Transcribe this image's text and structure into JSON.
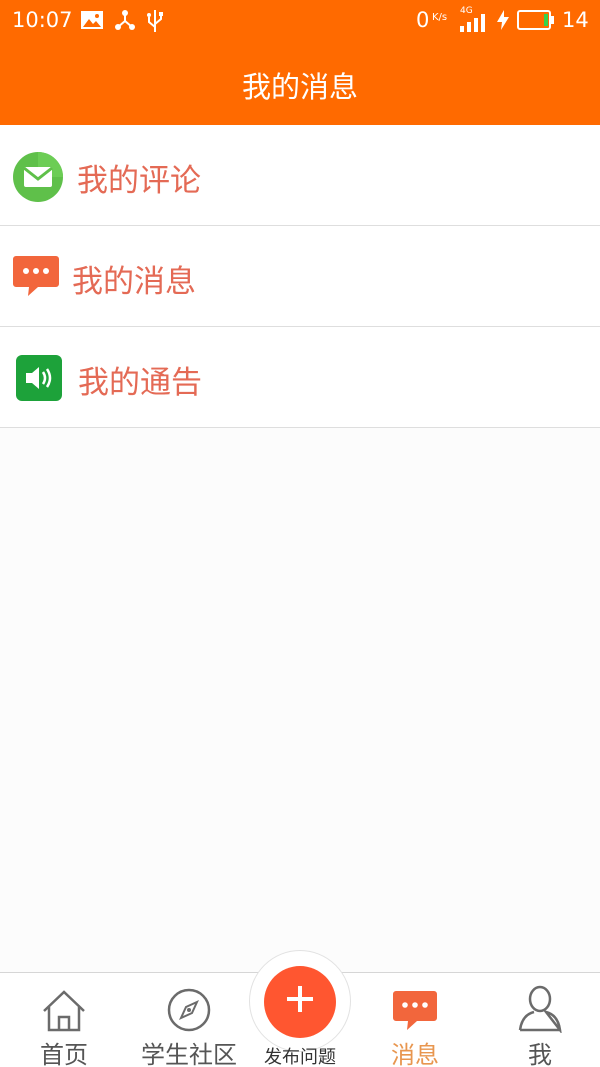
{
  "status_bar": {
    "time": "10:07",
    "net_speed": "0",
    "net_unit": "K/s",
    "network": "4G",
    "battery": "14"
  },
  "header": {
    "title": "我的消息"
  },
  "menu": {
    "items": [
      {
        "label": "我的评论",
        "icon": "envelope-icon",
        "color": "#5fc04a"
      },
      {
        "label": "我的消息",
        "icon": "chat-bubble-icon",
        "color": "#f2663c"
      },
      {
        "label": "我的通告",
        "icon": "speaker-icon",
        "color": "#1da23a"
      }
    ]
  },
  "bottom_nav": {
    "items": [
      {
        "label": "首页",
        "icon": "home-icon"
      },
      {
        "label": "学生社区",
        "icon": "compass-icon"
      },
      {
        "label": "发布问题",
        "icon": "plus-icon"
      },
      {
        "label": "消息",
        "icon": "chat-bubble-icon",
        "active": true
      },
      {
        "label": "我",
        "icon": "person-icon"
      }
    ]
  },
  "colors": {
    "brand": "#ff6a00",
    "menu_text": "#e46a55",
    "active_tab": "#e8964f",
    "publish": "#ff5630"
  }
}
